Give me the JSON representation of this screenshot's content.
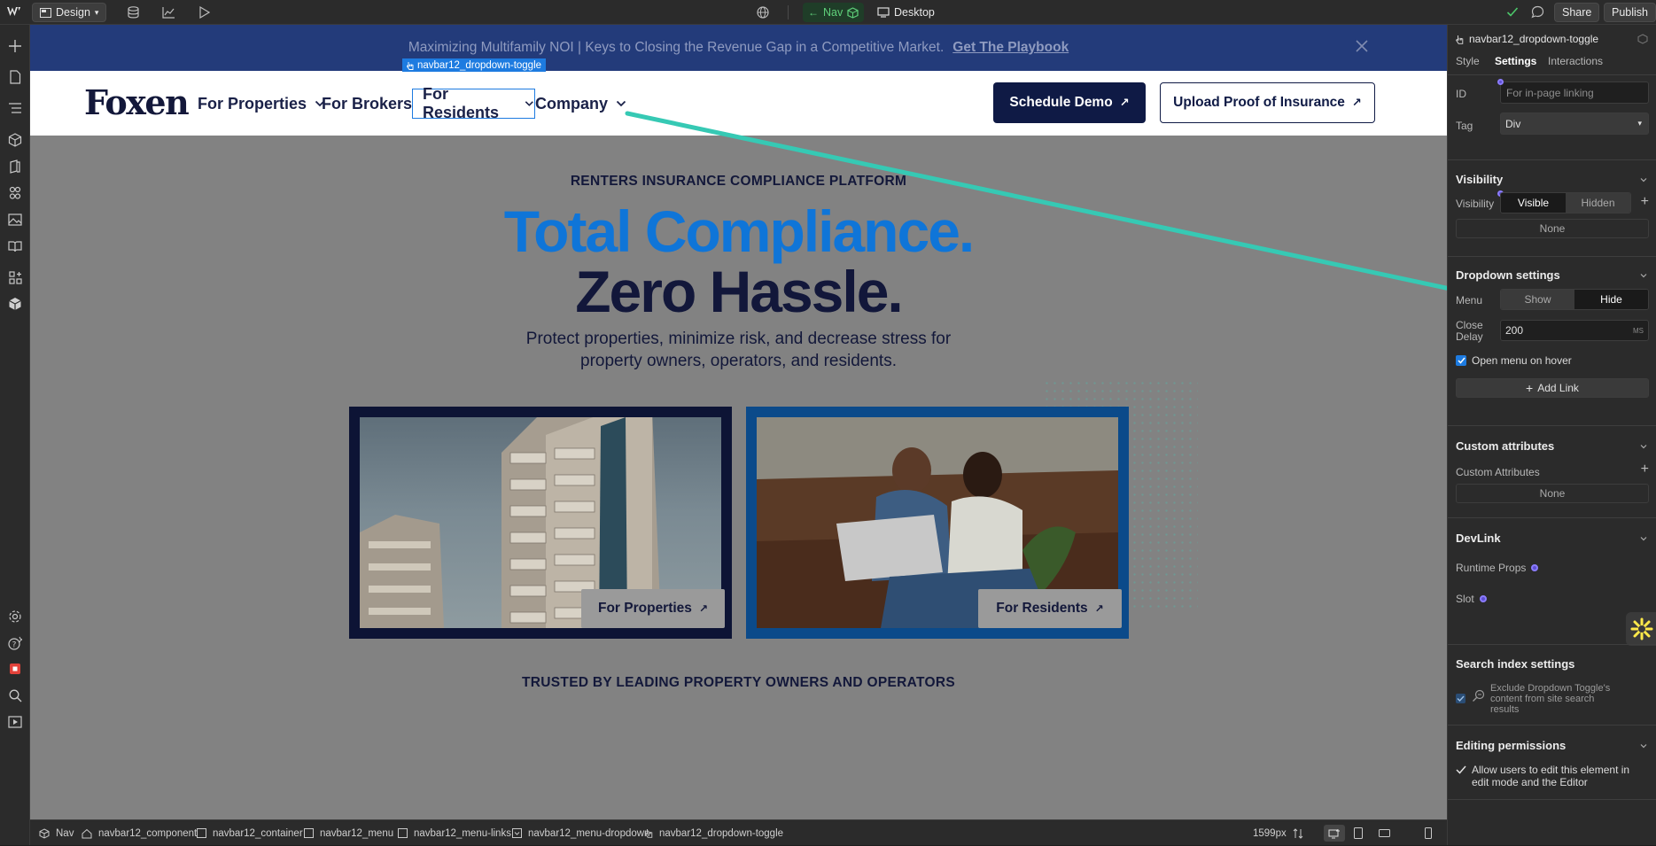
{
  "topbar": {
    "logo": "webflow-logo",
    "mode_label": "Design",
    "nav_badge": "Nav",
    "breakpoint_label": "Desktop",
    "share_label": "Share",
    "publish_label": "Publish"
  },
  "canvas": {
    "banner_text": "Maximizing Multifamily NOI | Keys to Closing the Revenue Gap in a Competitive Market.",
    "banner_link": "Get The Playbook",
    "selected_tag": "navbar12_dropdown-toggle",
    "logo_text": "Foxen",
    "nav": {
      "properties": "For Properties",
      "brokers": "For Brokers",
      "residents": "For Residents",
      "company": "Company"
    },
    "cta_primary": "Schedule Demo",
    "cta_secondary": "Upload Proof of Insurance",
    "eyebrow": "RENTERS INSURANCE COMPLIANCE PLATFORM",
    "headline_1": "Total Compliance.",
    "headline_2": "Zero Hassle.",
    "subhead_1": "Protect properties, minimize risk, and decrease stress for",
    "subhead_2": "property owners, operators, and residents.",
    "card_left_button": "For Properties",
    "card_right_button": "For Residents",
    "trusted": "TRUSTED BY LEADING PROPERTY OWNERS AND OPERATORS"
  },
  "bottombar": {
    "crumbs": [
      "Nav",
      "navbar12_component",
      "navbar12_container",
      "navbar12_menu",
      "navbar12_menu-links",
      "navbar12_menu-dropdown",
      "navbar12_dropdown-toggle"
    ],
    "width_readout": "1599px"
  },
  "panel": {
    "element_name": "navbar12_dropdown-toggle",
    "tabs": [
      "Style",
      "Settings",
      "Interactions"
    ],
    "id_label": "ID",
    "id_placeholder": "For in-page linking",
    "tag_label": "Tag",
    "tag_value": "Div",
    "visibility_title": "Visibility",
    "visibility_label": "Visibility",
    "visible_option": "Visible",
    "hidden_option": "Hidden",
    "none_1": "None",
    "dropdown_title": "Dropdown settings",
    "menu_label": "Menu",
    "show_option": "Show",
    "hide_option": "Hide",
    "close_label": "Close",
    "delay_label": "Delay",
    "delay_value": "200",
    "delay_unit": "MS",
    "open_on_hover": "Open menu on hover",
    "add_link": "Add Link",
    "custom_attrs_title": "Custom attributes",
    "custom_attrs_label": "Custom Attributes",
    "none_2": "None",
    "devlink_title": "DevLink",
    "runtime_props": "Runtime Props",
    "slot": "Slot",
    "search_title": "Search index settings",
    "search_text_1": "Exclude Dropdown Toggle's",
    "search_text_2": "content from site search",
    "search_text_3": "results",
    "editing_title": "Editing permissions",
    "editing_text_1": "Allow users to edit this element in",
    "editing_text_2": "edit mode and the Editor"
  },
  "colors": {
    "accent_blue": "#0f75d8",
    "navy": "#0f1a45",
    "teal_arrow": "#36c9b4",
    "webflow_blue": "#146ef5",
    "purple_dot": "#8b7cff"
  }
}
